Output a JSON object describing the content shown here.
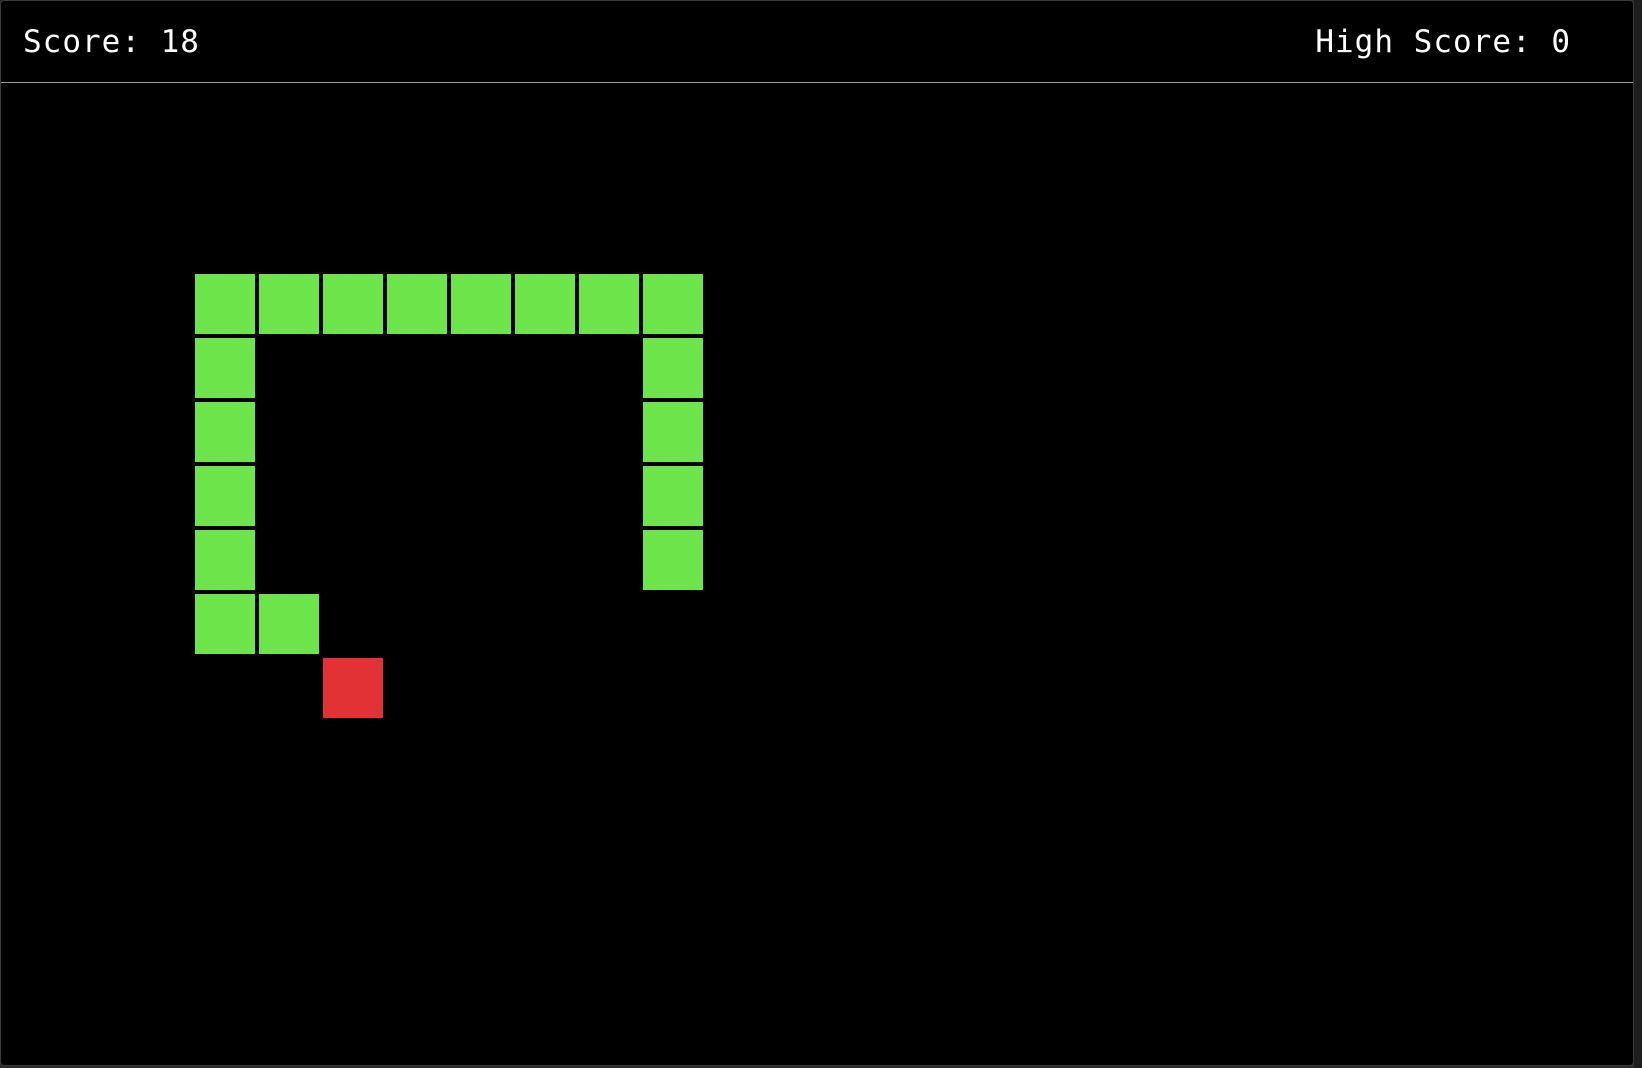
{
  "hud": {
    "score_text": "Score: 18",
    "high_score_text": "High Score: 0"
  },
  "game": {
    "score": 18,
    "high_score": 0,
    "snake_color": "#6de54a",
    "food_color": "#e33236",
    "background_color": "#000000",
    "snake_cells": [
      [
        0,
        0
      ],
      [
        1,
        0
      ],
      [
        2,
        0
      ],
      [
        3,
        0
      ],
      [
        4,
        0
      ],
      [
        5,
        0
      ],
      [
        6,
        0
      ],
      [
        7,
        0
      ],
      [
        0,
        1
      ],
      [
        7,
        1
      ],
      [
        0,
        2
      ],
      [
        7,
        2
      ],
      [
        0,
        3
      ],
      [
        7,
        3
      ],
      [
        0,
        4
      ],
      [
        7,
        4
      ],
      [
        0,
        5
      ],
      [
        1,
        5
      ]
    ],
    "food_cell": [
      2,
      6
    ]
  }
}
